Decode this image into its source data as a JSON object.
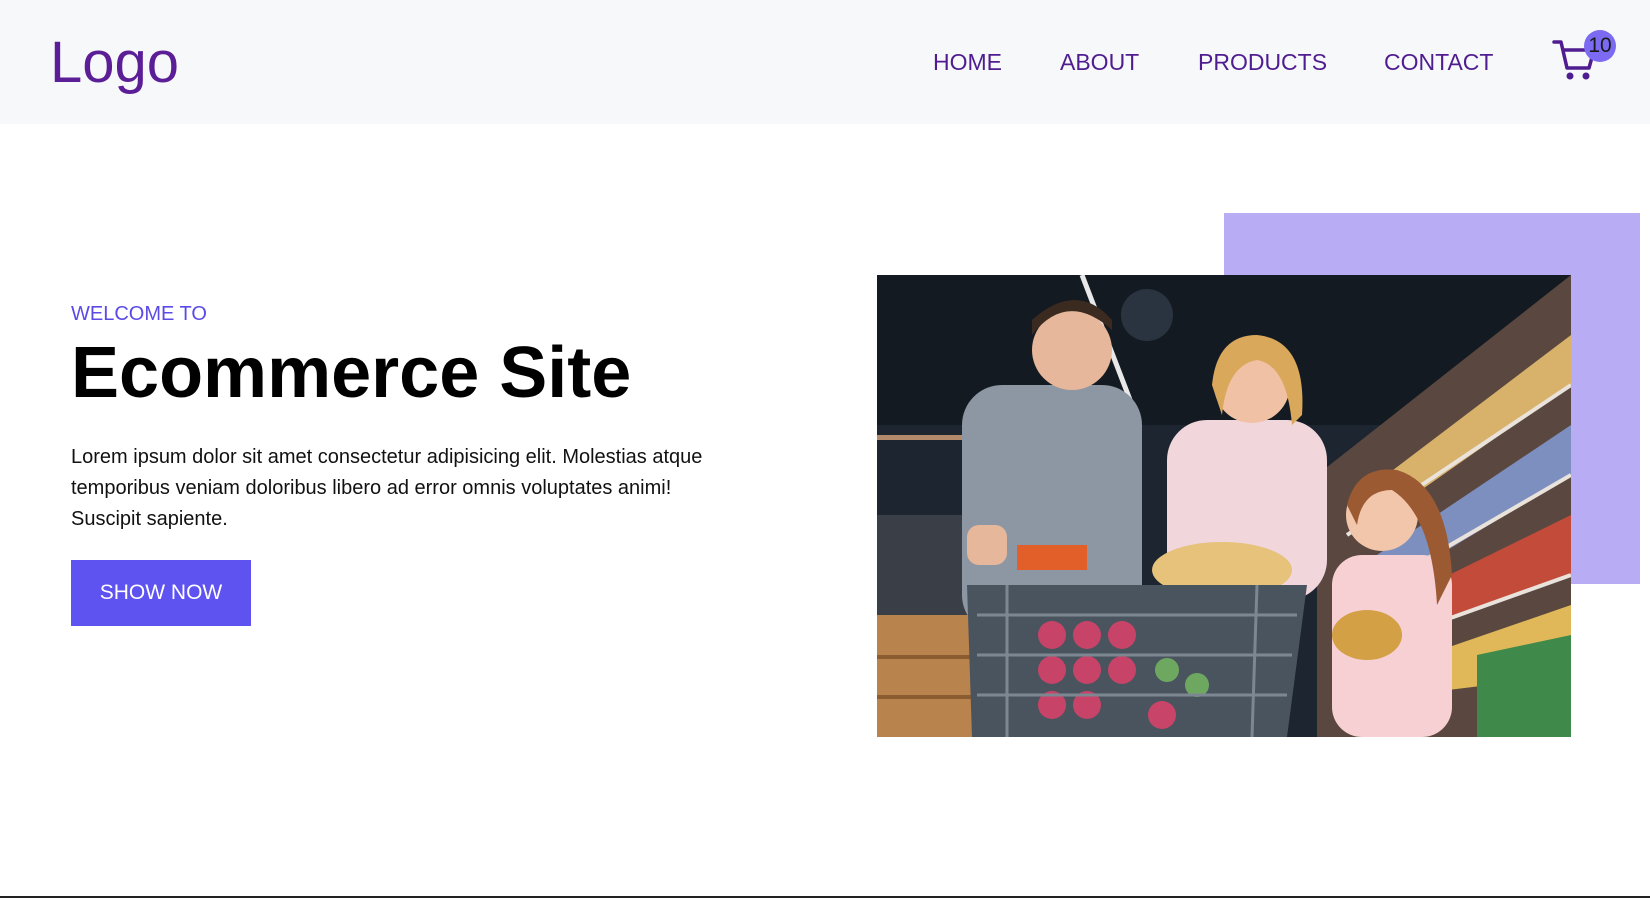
{
  "nav": {
    "logo": "Logo",
    "links": [
      {
        "label": "HOME"
      },
      {
        "label": "ABOUT"
      },
      {
        "label": "PRODUCTS"
      },
      {
        "label": "CONTACT"
      }
    ],
    "cart_count": "10"
  },
  "hero": {
    "welcome": "WELCOME TO",
    "title": "Ecommerce Site",
    "description": "Lorem ipsum dolor sit amet consectetur adipisicing elit. Molestias atque temporibus veniam doloribus libero ad error omnis voluptates animi! Suscipit sapiente.",
    "button_label": "SHOW NOW"
  },
  "colors": {
    "brand": "#5b1e96",
    "accent": "#5e52f0",
    "accent_light": "#b8adf5",
    "badge": "#7c6bf2"
  }
}
